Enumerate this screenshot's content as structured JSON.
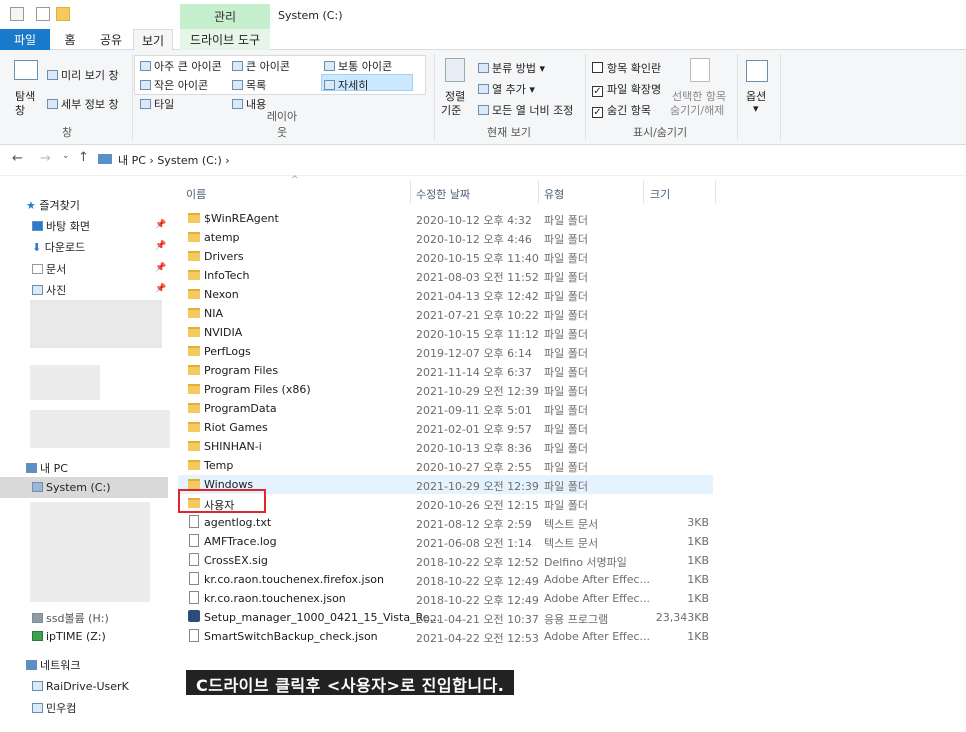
{
  "titlebar": {
    "context_tab": "관리",
    "window_title": "System (C:)"
  },
  "tabs": {
    "file": "파일",
    "home": "홈",
    "share": "공유",
    "view": "보기",
    "drive_tools": "드라이브 도구"
  },
  "ribbon": {
    "pane_group": {
      "nav_pane": "탐색",
      "nav_pane2": "창",
      "preview": "미리 보기 창",
      "details": "세부 정보 창",
      "label": "창"
    },
    "layout": {
      "xl_icons": "아주 큰 아이콘",
      "l_icons": "큰 아이콘",
      "m_icons": "보통 아이콘",
      "s_icons": "작은 아이콘",
      "list": "목록",
      "details": "자세히",
      "tiles": "타일",
      "content": "내용",
      "label": "레이아웃"
    },
    "current_view": {
      "sort": "정렬",
      "sort2": "기준",
      "group_by": "분류 방법",
      "add_column": "열 추가",
      "fit_columns": "모든 열 너비 조정",
      "label": "현재 보기"
    },
    "show_hide": {
      "item_checkboxes": "항목 확인란",
      "file_ext": "파일 확장명",
      "hidden_items": "숨긴 항목",
      "hide_selected": "선택한 항목",
      "hide_selected2": "숨기기/해제",
      "label": "표시/숨기기"
    },
    "options": "옵션"
  },
  "address": {
    "crumbs": "내 PC  ›  System (C:)  ›"
  },
  "navpane": {
    "quick_access": "즐겨찾기",
    "desktop": "바탕 화면",
    "downloads": "다운로드",
    "documents": "문서",
    "pictures": "사진",
    "this_pc": "내 PC",
    "system_c": "System (C:)",
    "ssd_h": "ssd볼륨 (H:)",
    "iptime": "ipTIME (Z:)",
    "network": "네트워크",
    "raidrive": "RaiDrive-UserK",
    "minwoo": "민우컴",
    "pin": "📌"
  },
  "columns": {
    "name": "이름",
    "date": "수정한 날짜",
    "type": "유형",
    "size": "크기"
  },
  "files": [
    {
      "name": "$WinREAgent",
      "date": "2020-10-12 오후 4:32",
      "type": "파일 폴더",
      "size": ""
    },
    {
      "name": "atemp",
      "date": "2020-10-12 오후 4:46",
      "type": "파일 폴더",
      "size": ""
    },
    {
      "name": "Drivers",
      "date": "2020-10-15 오후 11:40",
      "type": "파일 폴더",
      "size": ""
    },
    {
      "name": "InfoTech",
      "date": "2021-08-03 오전 11:52",
      "type": "파일 폴더",
      "size": ""
    },
    {
      "name": "Nexon",
      "date": "2021-04-13 오후 12:42",
      "type": "파일 폴더",
      "size": ""
    },
    {
      "name": "NIA",
      "date": "2021-07-21 오후 10:22",
      "type": "파일 폴더",
      "size": ""
    },
    {
      "name": "NVIDIA",
      "date": "2020-10-15 오후 11:12",
      "type": "파일 폴더",
      "size": ""
    },
    {
      "name": "PerfLogs",
      "date": "2019-12-07 오후 6:14",
      "type": "파일 폴더",
      "size": ""
    },
    {
      "name": "Program Files",
      "date": "2021-11-14 오후 6:37",
      "type": "파일 폴더",
      "size": ""
    },
    {
      "name": "Program Files (x86)",
      "date": "2021-10-29 오전 12:39",
      "type": "파일 폴더",
      "size": ""
    },
    {
      "name": "ProgramData",
      "date": "2021-09-11 오후 5:01",
      "type": "파일 폴더",
      "size": ""
    },
    {
      "name": "Riot Games",
      "date": "2021-02-01 오후 9:57",
      "type": "파일 폴더",
      "size": ""
    },
    {
      "name": "SHINHAN-i",
      "date": "2020-10-13 오후 8:36",
      "type": "파일 폴더",
      "size": ""
    },
    {
      "name": "Temp",
      "date": "2020-10-27 오후 2:55",
      "type": "파일 폴더",
      "size": ""
    },
    {
      "name": "Windows",
      "date": "2021-10-29 오전 12:39",
      "type": "파일 폴더",
      "size": ""
    },
    {
      "name": "사용자",
      "date": "2020-10-26 오전 12:15",
      "type": "파일 폴더",
      "size": ""
    },
    {
      "name": "agentlog.txt",
      "date": "2021-08-12 오후 2:59",
      "type": "텍스트 문서",
      "size": "3KB"
    },
    {
      "name": "AMFTrace.log",
      "date": "2021-06-08 오전 1:14",
      "type": "텍스트 문서",
      "size": "1KB"
    },
    {
      "name": "CrossEX.sig",
      "date": "2018-10-22 오후 12:52",
      "type": "Delfino 서명파일",
      "size": "1KB"
    },
    {
      "name": "kr.co.raon.touchenex.firefox.json",
      "date": "2018-10-22 오후 12:49",
      "type": "Adobe After Effec...",
      "size": "1KB"
    },
    {
      "name": "kr.co.raon.touchenex.json",
      "date": "2018-10-22 오후 12:49",
      "type": "Adobe After Effec...",
      "size": "1KB"
    },
    {
      "name": "Setup_manager_1000_0421_15_Vista_Re...",
      "date": "2021-04-21 오전 10:37",
      "type": "응용 프로그램",
      "size": "23,343KB"
    },
    {
      "name": "SmartSwitchBackup_check.json",
      "date": "2021-04-22 오전 12:53",
      "type": "Adobe After Effec...",
      "size": "1KB"
    }
  ],
  "caption": "C드라이브 클릭후 <사용자>로 진입합니다."
}
